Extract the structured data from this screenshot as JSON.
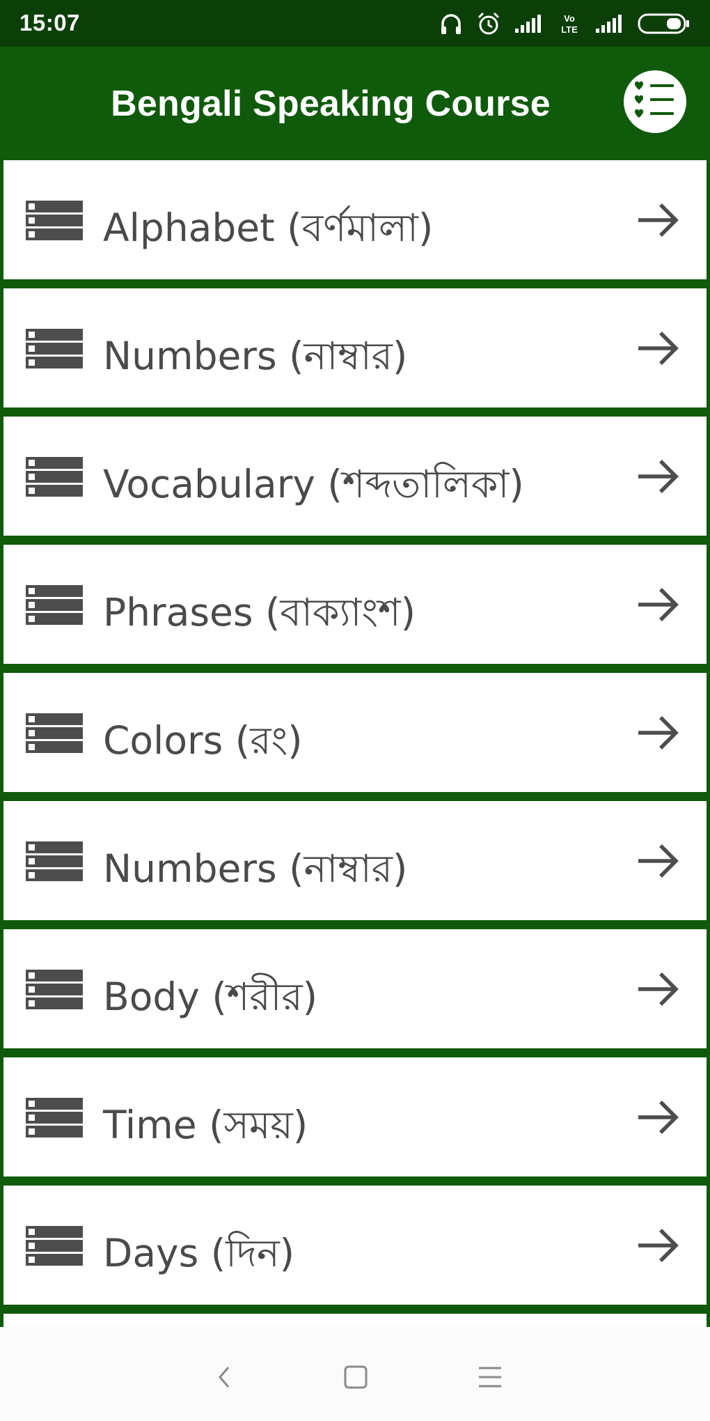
{
  "status_bar": {
    "time": "15:07",
    "icons": [
      "headphones-icon",
      "alarm-icon",
      "signal-icon",
      "volte-icon",
      "signal-icon",
      "battery-icon"
    ],
    "volte_label": "Vo LTE"
  },
  "app_bar": {
    "title": "Bengali Speaking Course",
    "menu_icon": "checklist-icon"
  },
  "list": {
    "items": [
      {
        "label": "Alphabet (বর্ণমালা)",
        "icon": "list-icon",
        "action_icon": "arrow-right-icon"
      },
      {
        "label": "Numbers (নাম্বার)",
        "icon": "list-icon",
        "action_icon": "arrow-right-icon"
      },
      {
        "label": "Vocabulary (শব্দতালিকা)",
        "icon": "list-icon",
        "action_icon": "arrow-right-icon"
      },
      {
        "label": "Phrases (বাক্যাংশ)",
        "icon": "list-icon",
        "action_icon": "arrow-right-icon"
      },
      {
        "label": "Colors (রং)",
        "icon": "list-icon",
        "action_icon": "arrow-right-icon"
      },
      {
        "label": "Numbers (নাম্বার)",
        "icon": "list-icon",
        "action_icon": "arrow-right-icon"
      },
      {
        "label": "Body (শরীর)",
        "icon": "list-icon",
        "action_icon": "arrow-right-icon"
      },
      {
        "label": "Time (সময়)",
        "icon": "list-icon",
        "action_icon": "arrow-right-icon"
      },
      {
        "label": "Days (দিন)",
        "icon": "list-icon",
        "action_icon": "arrow-right-icon"
      }
    ]
  },
  "nav_bar": {
    "buttons": [
      "back-icon",
      "home-icon",
      "recents-icon"
    ]
  },
  "colors": {
    "app_bar": "#0f5a0b",
    "status_bar": "#0b3f07",
    "item_background": "#ffffff",
    "item_text": "#4a4a4a",
    "icon": "#4d4d4d"
  }
}
